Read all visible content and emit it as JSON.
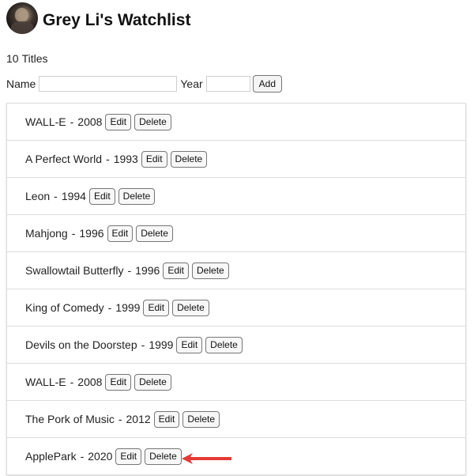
{
  "header": {
    "title": "Grey Li's Watchlist",
    "avatar": "avatar-icon"
  },
  "summary": {
    "count": "10",
    "suffix": "Titles"
  },
  "form": {
    "name_label": "Name",
    "name_value": "",
    "year_label": "Year",
    "year_value": "",
    "add_label": "Add"
  },
  "movies": [
    {
      "title": "WALL-E",
      "year": "2008",
      "edit": "Edit",
      "delete": "Delete"
    },
    {
      "title": "A Perfect World",
      "year": "1993",
      "edit": "Edit",
      "delete": "Delete"
    },
    {
      "title": "Leon",
      "year": "1994",
      "edit": "Edit",
      "delete": "Delete"
    },
    {
      "title": "Mahjong",
      "year": "1996",
      "edit": "Edit",
      "delete": "Delete"
    },
    {
      "title": "Swallowtail Butterfly",
      "year": "1996",
      "edit": "Edit",
      "delete": "Delete"
    },
    {
      "title": "King of Comedy",
      "year": "1999",
      "edit": "Edit",
      "delete": "Delete"
    },
    {
      "title": "Devils on the Doorstep",
      "year": "1999",
      "edit": "Edit",
      "delete": "Delete"
    },
    {
      "title": "WALL-E",
      "year": "2008",
      "edit": "Edit",
      "delete": "Delete"
    },
    {
      "title": "The Pork of Music",
      "year": "2012",
      "edit": "Edit",
      "delete": "Delete"
    },
    {
      "title": "ApplePark",
      "year": "2020",
      "edit": "Edit",
      "delete": "Delete"
    }
  ],
  "separator": "-",
  "annotation": {
    "icon": "red-arrow-icon",
    "color": "#e53935"
  }
}
